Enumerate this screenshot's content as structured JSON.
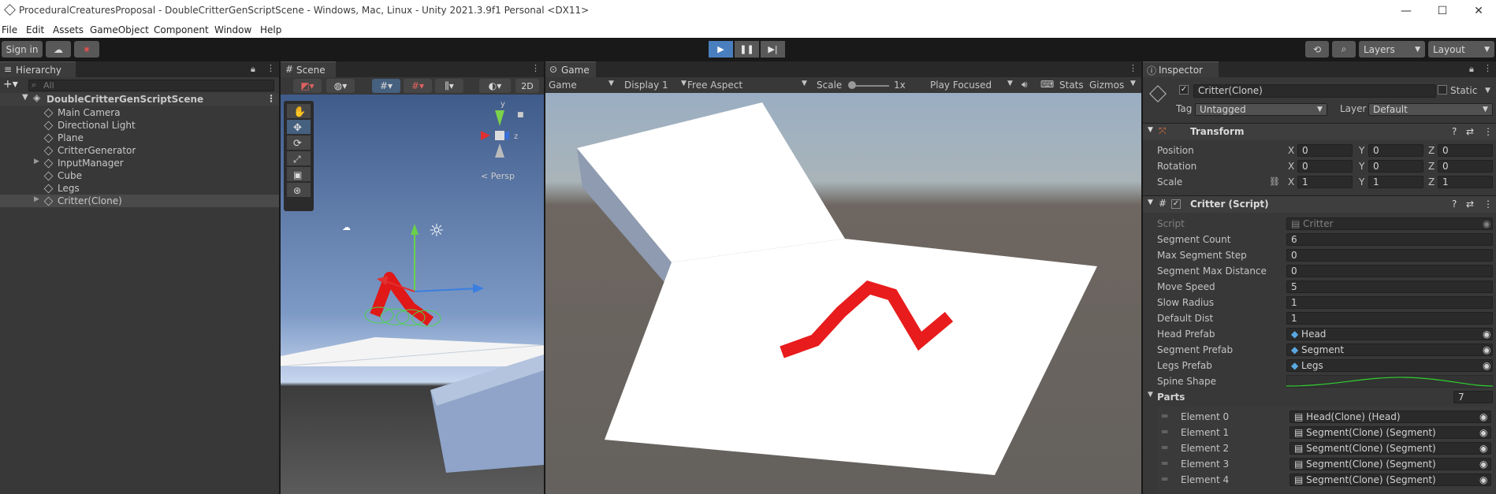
{
  "window": {
    "title": "ProceduralCreaturesProposal - DoubleCritterGenScriptScene - Windows, Mac, Linux - Unity 2021.3.9f1 Personal <DX11>",
    "minimize": "—",
    "maximize": "☐",
    "close": "✕"
  },
  "menu": [
    "File",
    "Edit",
    "Assets",
    "GameObject",
    "Component",
    "Window",
    "Help"
  ],
  "toolbar": {
    "sign_in": "Sign in",
    "layers": "Layers",
    "layout": "Layout",
    "play_icon": "play-icon",
    "pause_icon": "pause-icon",
    "step_icon": "step-icon"
  },
  "hierarchy": {
    "tab": "Hierarchy",
    "search_placeholder": "All",
    "scene": "DoubleCritterGenScriptScene",
    "items": [
      "Main Camera",
      "Directional Light",
      "Plane",
      "CritterGenerator",
      "InputManager",
      "Cube",
      "Legs",
      "Critter(Clone)"
    ]
  },
  "scene": {
    "tab": "Scene",
    "persp": "< Persp",
    "mode_2d": "2D",
    "axis_y": "y",
    "axis_z": "z"
  },
  "game": {
    "tab": "Game",
    "mode": "Game",
    "display": "Display 1",
    "aspect": "Free Aspect",
    "scale_label": "Scale",
    "scale_value": "1x",
    "play_focused": "Play Focused",
    "stats": "Stats",
    "gizmos": "Gizmos"
  },
  "inspector": {
    "tab": "Inspector",
    "object_name": "Critter(Clone)",
    "static_label": "Static",
    "tag_label": "Tag",
    "tag_value": "Untagged",
    "layer_label": "Layer",
    "layer_value": "Default",
    "transform": {
      "title": "Transform",
      "position_label": "Position",
      "rotation_label": "Rotation",
      "scale_label": "Scale",
      "position": [
        "0",
        "0",
        "0"
      ],
      "rotation": [
        "0",
        "0",
        "0"
      ],
      "scale": [
        "1",
        "1",
        "1"
      ],
      "x": "X",
      "y": "Y",
      "z": "Z"
    },
    "critter": {
      "title": "Critter (Script)",
      "script_label": "Script",
      "script_value": "Critter",
      "segment_count_label": "Segment Count",
      "segment_count": "6",
      "max_segment_step_label": "Max Segment Step",
      "max_segment_step": "0",
      "segment_max_distance_label": "Segment Max Distance",
      "segment_max_distance": "0",
      "move_speed_label": "Move Speed",
      "move_speed": "5",
      "slow_radius_label": "Slow Radius",
      "slow_radius": "1",
      "default_dist_label": "Default Dist",
      "default_dist": "1",
      "head_prefab_label": "Head Prefab",
      "head_prefab": "Head",
      "segment_prefab_label": "Segment Prefab",
      "segment_prefab": "Segment",
      "legs_prefab_label": "Legs Prefab",
      "legs_prefab": "Legs",
      "spine_shape_label": "Spine Shape",
      "parts_label": "Parts",
      "parts_count": "7",
      "parts": [
        {
          "label": "Element 0",
          "value": "Head(Clone) (Head)"
        },
        {
          "label": "Element 1",
          "value": "Segment(Clone) (Segment)"
        },
        {
          "label": "Element 2",
          "value": "Segment(Clone) (Segment)"
        },
        {
          "label": "Element 3",
          "value": "Segment(Clone) (Segment)"
        },
        {
          "label": "Element 4",
          "value": "Segment(Clone) (Segment)"
        }
      ]
    }
  },
  "colors": {
    "accent": "#4a7fbf",
    "critter_red": "#e81c1c",
    "panel_bg": "#383838"
  }
}
